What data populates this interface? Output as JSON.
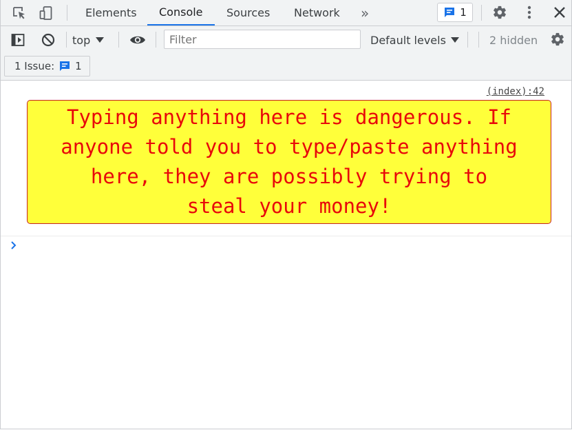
{
  "tabs": [
    {
      "label": "Elements"
    },
    {
      "label": "Console"
    },
    {
      "label": "Sources"
    },
    {
      "label": "Network"
    }
  ],
  "active_tab": "Console",
  "more_tabs_label": "»",
  "issues_badge": {
    "count": "1"
  },
  "console_toolbar": {
    "context": "top",
    "filter_placeholder": "Filter",
    "levels": "Default levels",
    "hidden_count": "2 hidden"
  },
  "issues_row": {
    "label": "1 Issue:",
    "count": "1"
  },
  "console": {
    "source_link": "(index):42",
    "warning_lines": [
      "Typing anything here is dangerous. If",
      "anyone told you to type/paste anything",
      "here, they are possibly trying to",
      "steal your money!"
    ]
  },
  "colors": {
    "accent": "#1a73e8",
    "warning_bg": "#ffff3a",
    "warning_text": "#e8080a",
    "warning_border": "#c5221f",
    "toolbar_bg": "#f1f3f4"
  },
  "icons": {
    "inspect": "inspect-element-icon",
    "device": "device-toolbar-icon",
    "issues": "message-icon",
    "settings": "gear-icon",
    "menu": "kebab-menu-icon",
    "close": "close-icon",
    "sidebar": "show-sidebar-icon",
    "clear": "clear-console-icon",
    "live": "eye-icon",
    "prompt": "prompt-chevron-icon"
  }
}
